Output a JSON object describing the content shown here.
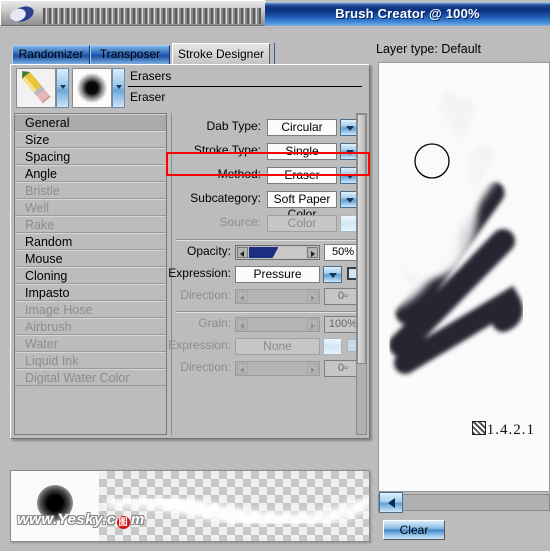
{
  "window": {
    "title": "Brush Creator @ 100%",
    "logo_icon": "painter-brush-icon"
  },
  "tabs": [
    {
      "label": "Randomizer",
      "active": false
    },
    {
      "label": "Transposer",
      "active": false
    },
    {
      "label": "Stroke Designer",
      "active": true
    }
  ],
  "brush_selector": {
    "category_icon": "pencil-eraser-icon",
    "variant_icon": "soft-round-dab-icon",
    "category": "Erasers",
    "variant": "Eraser",
    "chevron_icon": "chevron-down-icon"
  },
  "categories": [
    {
      "label": "General",
      "enabled": true,
      "selected": true
    },
    {
      "label": "Size",
      "enabled": true,
      "selected": false
    },
    {
      "label": "Spacing",
      "enabled": true,
      "selected": false
    },
    {
      "label": "Angle",
      "enabled": true,
      "selected": false
    },
    {
      "label": "Bristle",
      "enabled": false,
      "selected": false
    },
    {
      "label": "Well",
      "enabled": false,
      "selected": false
    },
    {
      "label": "Rake",
      "enabled": false,
      "selected": false
    },
    {
      "label": "Random",
      "enabled": true,
      "selected": false
    },
    {
      "label": "Mouse",
      "enabled": true,
      "selected": false
    },
    {
      "label": "Cloning",
      "enabled": true,
      "selected": false
    },
    {
      "label": "Impasto",
      "enabled": true,
      "selected": false
    },
    {
      "label": "Image Hose",
      "enabled": false,
      "selected": false
    },
    {
      "label": "Airbrush",
      "enabled": false,
      "selected": false
    },
    {
      "label": "Water",
      "enabled": false,
      "selected": false
    },
    {
      "label": "Liquid Ink",
      "enabled": false,
      "selected": false
    },
    {
      "label": "Digital Water Color",
      "enabled": false,
      "selected": false
    }
  ],
  "controls": {
    "dab_type": {
      "label": "Dab Type:",
      "value": "Circular"
    },
    "stroke_type": {
      "label": "Stroke Type:",
      "value": "Single"
    },
    "method": {
      "label": "Method:",
      "value": "Eraser",
      "highlighted": true,
      "highlight_color": "#ff0000"
    },
    "subcategory": {
      "label": "Subcategory:",
      "value": "Soft Paper Color"
    },
    "source": {
      "label": "Source:",
      "value": "Color",
      "enabled": false
    },
    "opacity": {
      "label": "Opacity:",
      "value": "50%",
      "percent": 50
    },
    "opacity_expression": {
      "label": "Expression:",
      "value": "Pressure",
      "checkbox": false
    },
    "opacity_direction": {
      "label": "Direction:",
      "value": "0▫",
      "enabled": false
    },
    "grain": {
      "label": "Grain:",
      "value": "100%",
      "percent": 100,
      "enabled": false
    },
    "grain_expression": {
      "label": "Expression:",
      "value": "None",
      "enabled": false
    },
    "grain_direction": {
      "label": "Direction:",
      "value": "0▫",
      "enabled": false
    }
  },
  "preview": {
    "dab_name": "dab-preview",
    "stroke_name": "stroke-preview",
    "watermark_prefix": "www.Yesky.c",
    "watermark_logo": "图",
    "watermark_suffix": "m"
  },
  "right": {
    "layer_type": "Layer type: Default",
    "figure_number": "1.4.2.1",
    "back_button_icon": "chevron-left-icon",
    "clear_button": "Clear"
  }
}
